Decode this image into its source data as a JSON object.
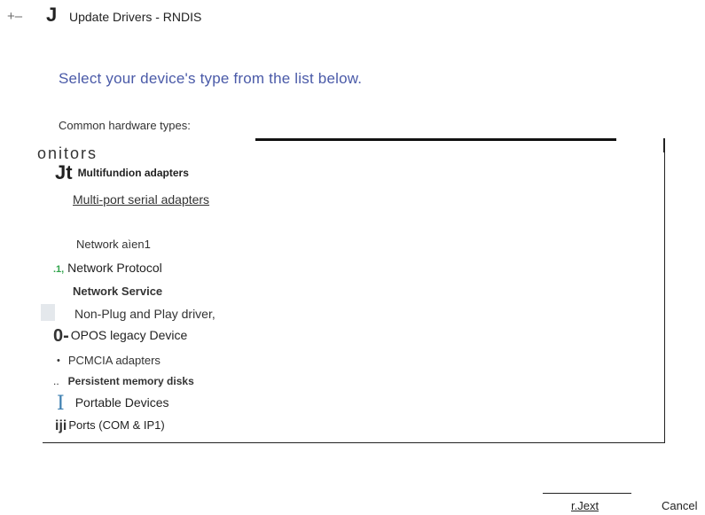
{
  "header": {
    "back_glyph": "+–",
    "app_glyph": "J",
    "title": "Update Drivers - RNDIS"
  },
  "instruction": "Select your device's type from the list below.",
  "list": {
    "label": "Common hardware types:",
    "items": [
      {
        "icon": "",
        "label": "onitors"
      },
      {
        "icon": "Jt",
        "label": "Multifundion adapters"
      },
      {
        "icon": "",
        "label": "Multi-port serial adapters"
      },
      {
        "icon": "",
        "label": "Network aìen1"
      },
      {
        "icon": ".1,",
        "label": " Network Protocol"
      },
      {
        "icon": "",
        "label": "Network  Service"
      },
      {
        "icon": "",
        "label": "Non-Plug and Play driver,"
      },
      {
        "icon": "0-",
        "label": "OPOS legacy Device"
      },
      {
        "icon": "•",
        "label": "PCMCIA adapters"
      },
      {
        "icon": "..",
        "label": "Persistent memory disks"
      },
      {
        "icon": "I",
        "label": "Portable Devices"
      },
      {
        "icon": "iji",
        "label": "Ports (COM & IP1)"
      }
    ]
  },
  "footer": {
    "next_label": "r.Jext",
    "cancel_label": "Cancel"
  }
}
